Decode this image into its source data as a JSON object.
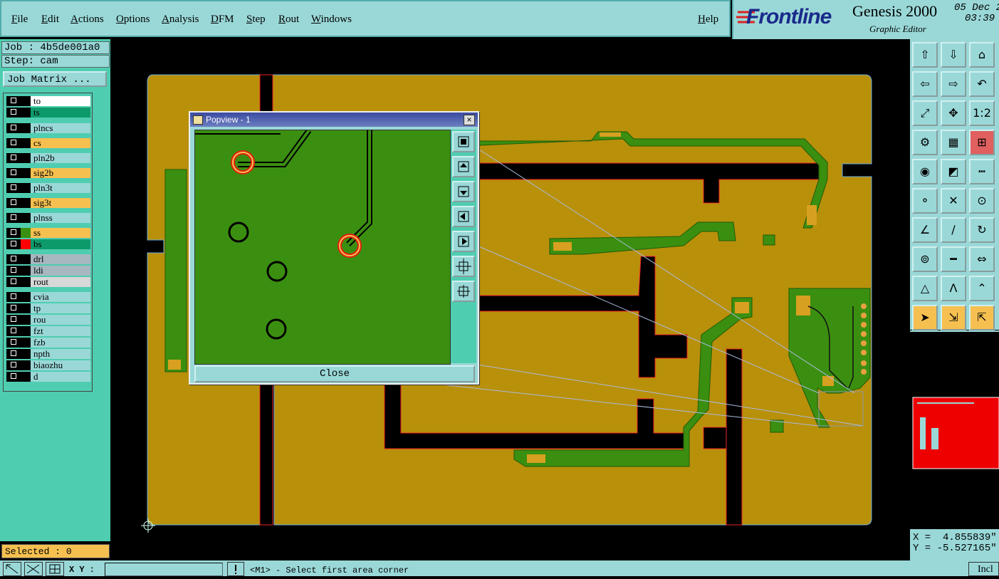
{
  "menu": {
    "items": [
      "File",
      "Edit",
      "Actions",
      "Options",
      "Analysis",
      "DFM",
      "Step",
      "Rout",
      "Windows"
    ],
    "help": "Help"
  },
  "brand": {
    "logo": "Frontline",
    "product": "Genesis 2000",
    "subtitle": "Graphic Editor",
    "date": "05 Dec 2",
    "time": "03:39"
  },
  "job": {
    "job_line": "Job : 4b5de001a0",
    "step_line": "Step: cam",
    "matrix_button": "Job Matrix ..."
  },
  "layers": [
    {
      "name": "to",
      "bg": "#ffffff",
      "color": "#000000"
    },
    {
      "name": "ts",
      "bg": "#0d9a6a",
      "color": "#000000"
    },
    {
      "name": "plncs",
      "bg": "#9ad8d8",
      "color": "#000000"
    },
    {
      "name": "cs",
      "bg": "#f6c050",
      "color": "#000000"
    },
    {
      "name": "pln2b",
      "bg": "#9ad8d8",
      "color": "#000000"
    },
    {
      "name": "sig2b",
      "bg": "#f6c050",
      "color": "#000000"
    },
    {
      "name": "pln3t",
      "bg": "#9ad8d8",
      "color": "#000000"
    },
    {
      "name": "sig3t",
      "bg": "#f6c050",
      "color": "#000000"
    },
    {
      "name": "plnss",
      "bg": "#9ad8d8",
      "color": "#000000"
    },
    {
      "name": "ss",
      "bg": "#f6c050",
      "color": "#3b8f10"
    },
    {
      "name": "bs",
      "bg": "#0d9a6a",
      "color": "#ff0000"
    },
    {
      "name": "drl",
      "bg": "#a8b8c0",
      "color": "#000000"
    },
    {
      "name": "ldi",
      "bg": "#a8b8c0",
      "color": "#000000"
    },
    {
      "name": "rout",
      "bg": "#d8d8d8",
      "color": "#000000"
    },
    {
      "name": "cvia",
      "bg": "#9ad8d8",
      "color": "#000000"
    },
    {
      "name": "tp",
      "bg": "#9ad8d8",
      "color": "#000000"
    },
    {
      "name": "rou",
      "bg": "#9ad8d8",
      "color": "#000000"
    },
    {
      "name": "fzt",
      "bg": "#9ad8d8",
      "color": "#000000"
    },
    {
      "name": "fzb",
      "bg": "#9ad8d8",
      "color": "#000000"
    },
    {
      "name": "npth",
      "bg": "#9ad8d8",
      "color": "#000000"
    },
    {
      "name": "biaozhu",
      "bg": "#9ad8d8",
      "color": "#000000"
    },
    {
      "name": "d",
      "bg": "#9ad8d8",
      "color": "#000000"
    }
  ],
  "status": {
    "selected": "Selected : 0"
  },
  "bottom": {
    "xy_label": "X Y :",
    "message": "<M1> - Select first area corner",
    "incl": "Incl"
  },
  "coords": {
    "x": "X =  4.855839\"",
    "y": "Y = -5.527165\""
  },
  "popup": {
    "title": "Popview - 1",
    "close_x": "×",
    "close_button": "Close"
  },
  "colors": {
    "panel": "#9ad8d8",
    "board": "#b8900a",
    "copper": "#3b8f10",
    "accent": "#f6c050"
  }
}
